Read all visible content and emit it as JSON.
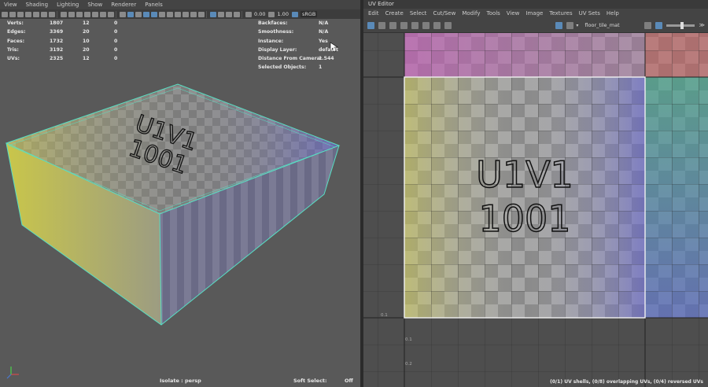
{
  "viewport": {
    "menu": [
      "View",
      "Shading",
      "Lighting",
      "Show",
      "Renderer",
      "Panels"
    ],
    "toolbar": {
      "near_value": "0.00",
      "far_value": "1.00",
      "color_space": "sRGB"
    },
    "stats": [
      {
        "label": "Verts:",
        "a": "1807",
        "b": "12",
        "c": "0"
      },
      {
        "label": "Edges:",
        "a": "3369",
        "b": "20",
        "c": "0"
      },
      {
        "label": "Faces:",
        "a": "1732",
        "b": "10",
        "c": "0"
      },
      {
        "label": "Tris:",
        "a": "3192",
        "b": "20",
        "c": "0"
      },
      {
        "label": "UVs:",
        "a": "2325",
        "b": "12",
        "c": "0"
      }
    ],
    "info": [
      {
        "label": "Backfaces:",
        "value": "N/A"
      },
      {
        "label": "Smoothness:",
        "value": "N/A"
      },
      {
        "label": "Instance:",
        "value": "Yes"
      },
      {
        "label": "Display Layer:",
        "value": "default"
      },
      {
        "label": "Distance From Camera:",
        "value": "1.544"
      },
      {
        "label": "Selected Objects:",
        "value": "1"
      }
    ],
    "texture_text": {
      "line1": "U1V1",
      "line2": "1001"
    },
    "footer": {
      "isolate": "Isolate : persp",
      "soft_select_label": "Soft Select:",
      "soft_select_value": "Off"
    },
    "axis": {
      "x": "x",
      "y": "y",
      "z": "z"
    }
  },
  "uv_editor": {
    "title": "UV Editor",
    "menu": [
      "Edit",
      "Create",
      "Select",
      "Cut/Sew",
      "Modify",
      "Tools",
      "View",
      "Image",
      "Textures",
      "UV Sets",
      "Help"
    ],
    "material": "floor_tile_mat",
    "texture_text": {
      "line1": "U1V1",
      "line2": "1001"
    },
    "ticks": [
      "0.1",
      "0.1",
      "0.2"
    ],
    "status": "(0/1) UV shells, (0/8) overlapping UVs, (0/4) reversed UVs",
    "colors": {
      "selection": "#f0f0f0",
      "grid": "#333333"
    }
  }
}
